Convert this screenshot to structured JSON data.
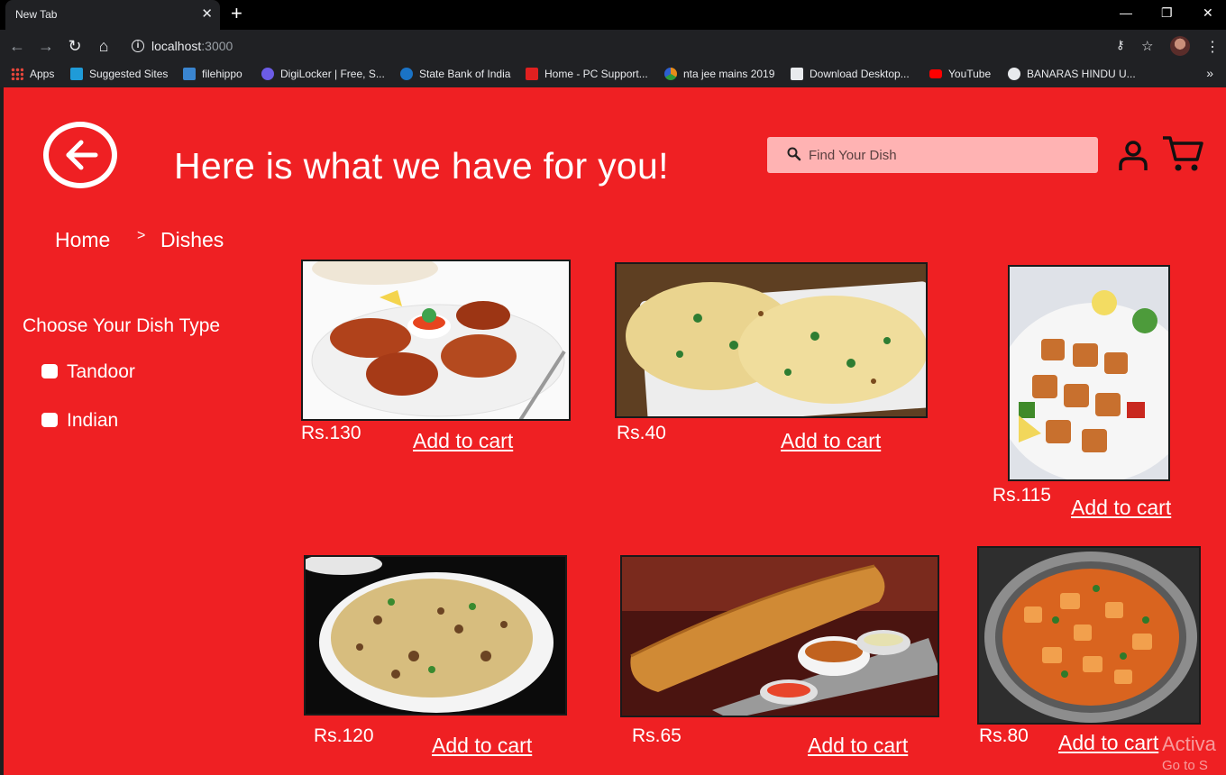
{
  "browser": {
    "tab_title": "New Tab",
    "tab_close": "✕",
    "new_tab": "+",
    "url_host": "localhost",
    "url_port": ":3000",
    "bookmarks": [
      {
        "label": "Apps",
        "color": "#e8eaed"
      },
      {
        "label": "Suggested Sites",
        "color": "#1f9bd8"
      },
      {
        "label": "filehippo",
        "color": "#3a85d0"
      },
      {
        "label": "DigiLocker | Free, S...",
        "color": "#6c5ce7"
      },
      {
        "label": "State Bank of India",
        "color": "#1a73c6"
      },
      {
        "label": "Home - PC Support...",
        "color": "#e02020"
      },
      {
        "label": "nta jee mains 2019",
        "color": "#e88b1a"
      },
      {
        "label": "Download Desktop...",
        "color": "#e8eaed"
      },
      {
        "label": "YouTube",
        "color": "#ff0000"
      },
      {
        "label": "BANARAS HINDU U...",
        "color": "#e8eaed"
      }
    ],
    "more": "»"
  },
  "header": {
    "title": "Here is what we have for you!",
    "search_placeholder": "Find Your Dish"
  },
  "breadcrumb": {
    "home": "Home",
    "separator": ">",
    "current": "Dishes"
  },
  "filters": {
    "title": "Choose Your Dish Type",
    "options": [
      "Tandoor",
      "Indian"
    ]
  },
  "dishes": [
    {
      "price": "Rs.130",
      "action": "Add to cart",
      "image": "tandoori-chicken"
    },
    {
      "price": "Rs.40",
      "action": "Add to cart",
      "image": "garlic-naan"
    },
    {
      "price": "Rs.115",
      "action": "Add to cart",
      "image": "paneer-tikka"
    },
    {
      "price": "Rs.120",
      "action": "Add to cart",
      "image": "biryani"
    },
    {
      "price": "Rs.65",
      "action": "Add to cart",
      "image": "masala-dosa"
    },
    {
      "price": "Rs.80",
      "action": "Add to cart",
      "image": "paneer-curry"
    }
  ],
  "watermark": {
    "line1": "Activa",
    "line2": "Go to S"
  },
  "colors": {
    "page_bg": "#ef2023",
    "search_bg": "#ffb3b3"
  }
}
